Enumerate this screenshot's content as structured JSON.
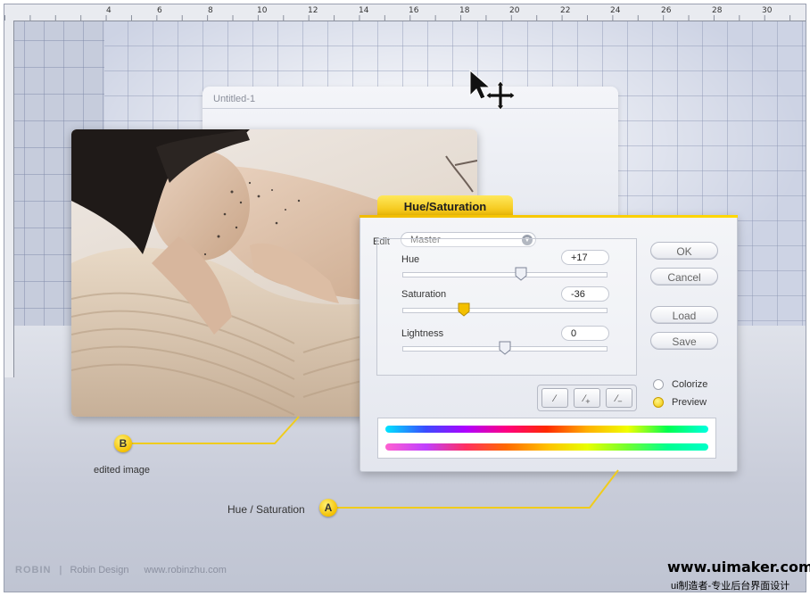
{
  "ruler": {
    "ticks": [
      "4",
      "6",
      "8",
      "10",
      "12",
      "14",
      "16",
      "18",
      "20",
      "22",
      "24",
      "26",
      "28",
      "30"
    ]
  },
  "document": {
    "title": "Untitled-1"
  },
  "dialog": {
    "title": "Hue/Saturation",
    "edit_label": "Edit",
    "edit_value": "Master",
    "sliders": [
      {
        "label": "Hue",
        "value": "+17",
        "fraction": 0.58
      },
      {
        "label": "Saturation",
        "value": "-36",
        "fraction": 0.3
      },
      {
        "label": "Lightness",
        "value": "0",
        "fraction": 0.5
      }
    ],
    "buttons": {
      "ok": "OK",
      "cancel": "Cancel",
      "load": "Load",
      "save": "Save"
    },
    "options": {
      "colorize": "Colorize",
      "preview": "Preview",
      "colorize_checked": false,
      "preview_checked": true
    }
  },
  "callouts": {
    "a": {
      "letter": "A",
      "caption": "Hue / Saturation"
    },
    "b": {
      "letter": "B",
      "caption": "edited image"
    }
  },
  "footer": {
    "logo": "ROBIN",
    "separator": "|",
    "company": "Robin Design",
    "url": "www.robinzhu.com"
  },
  "watermark": {
    "site": "www.uimaker.com",
    "subtitle": "ui制造者-专业后台界面设计"
  },
  "colors": {
    "accent": "#f4c000",
    "text": "#333333"
  },
  "icons": [
    "move-cursor-icon",
    "eyedropper-icon",
    "eyedropper-plus-icon",
    "eyedropper-minus-icon",
    "chevron-down-icon"
  ]
}
